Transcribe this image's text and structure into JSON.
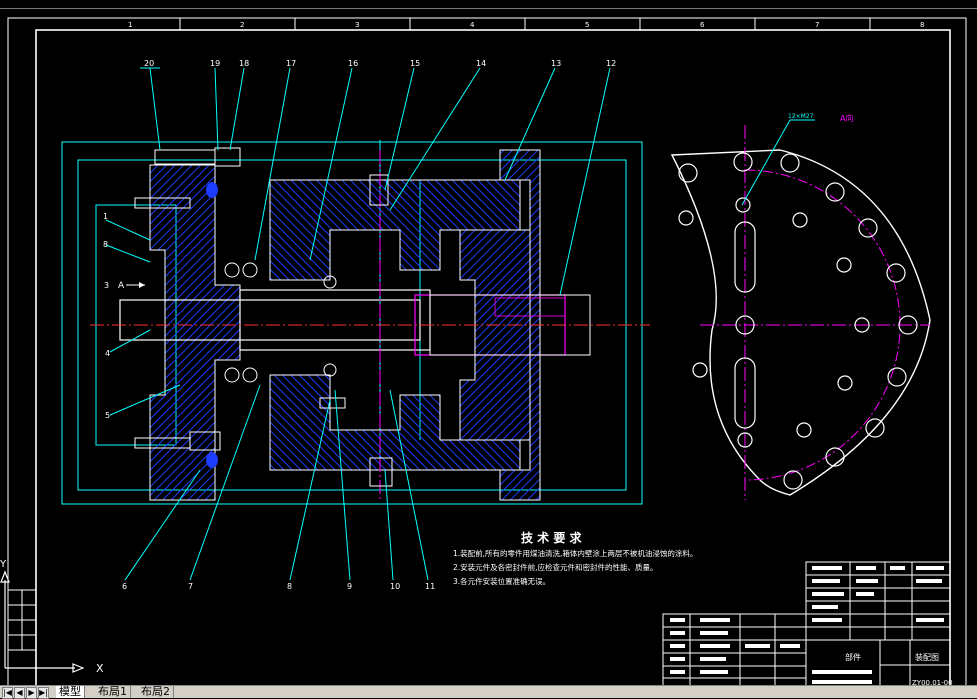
{
  "drawing": {
    "top_grid_labels": [
      "1",
      "2",
      "3",
      "4",
      "5",
      "6",
      "7",
      "8"
    ],
    "part_numbers_top": [
      "20",
      "19",
      "18",
      "17",
      "16",
      "15",
      "14",
      "13",
      "12"
    ],
    "part_numbers_left": [
      "1",
      "8",
      "3",
      "4",
      "5"
    ],
    "part_numbers_bottom": [
      "6",
      "7",
      "8",
      "9",
      "10",
      "11"
    ],
    "arrow_label": "A",
    "view_label": "A向",
    "hole_spec": "12×M27",
    "tech_req_title": "技 术 要 求",
    "tech_req_items": [
      "1.装配前,所有的零件用煤油清洗,箱体内壁涂上两层不被机油浸蚀的涂料。",
      "2.安装元件及各密封件前,应检查元件和密封件的性能、质量。",
      "3.各元件安装位置准确无误。"
    ],
    "title_block": {
      "name": "装配图",
      "label": "部件",
      "drawing_no": "ZY00.01-00"
    }
  },
  "ucs": {
    "y_label": "Y",
    "x_label": "X"
  },
  "tabs": {
    "model": "模型",
    "layout1": "布局1",
    "layout2": "布局2"
  },
  "colors": {
    "background": "#000000",
    "outline": "#ffffff",
    "dims": "#00ffff",
    "hatch": "#1e3cff",
    "center": "#ff00ff",
    "leader": "#00ffff"
  }
}
